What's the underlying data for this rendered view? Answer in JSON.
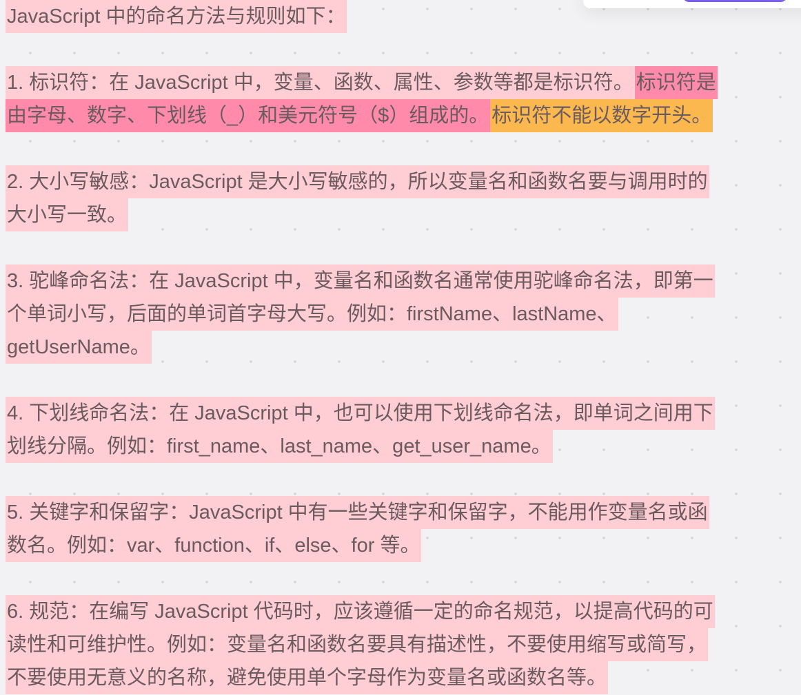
{
  "colors": {
    "light": "#ffcdd4",
    "pink": "#ff8aaa",
    "orange": "#fbb84f",
    "accent": "#7b5cf5"
  },
  "paragraphs": [
    [
      [
        {
          "t": "JavaScript 中的命名方法与规则如下：",
          "h": "light"
        }
      ]
    ],
    [
      [
        {
          "t": "1. 标识符：在 JavaScript 中，变量、函数、属性、参数等都是标识符。",
          "h": "light"
        },
        {
          "t": "标识符是",
          "h": "pink"
        }
      ],
      [
        {
          "t": "由字母、数字、下划线（_）和美元符号（$）组成的。",
          "h": "pink"
        },
        {
          "t": "标识符不能以数字开头。",
          "h": "orange"
        }
      ]
    ],
    [
      [
        {
          "t": "2. 大小写敏感：JavaScript 是大小写敏感的，所以变量名和函数名要与调用时的",
          "h": "light"
        }
      ],
      [
        {
          "t": "大小写一致。",
          "h": "light"
        }
      ]
    ],
    [
      [
        {
          "t": "3. 驼峰命名法：在 JavaScript 中，变量名和函数名通常使用驼峰命名法，即第一",
          "h": "light"
        }
      ],
      [
        {
          "t": "个单词小写，后面的单词首字母大写。例如：firstName、lastName、",
          "h": "light"
        }
      ],
      [
        {
          "t": "getUserName。",
          "h": "light"
        }
      ]
    ],
    [
      [
        {
          "t": "4. 下划线命名法：在 JavaScript 中，也可以使用下划线命名法，即单词之间用下",
          "h": "light"
        }
      ],
      [
        {
          "t": "划线分隔。例如：first_name、last_name、get_user_name。",
          "h": "light"
        }
      ]
    ],
    [
      [
        {
          "t": "5. 关键字和保留字：JavaScript 中有一些关键字和保留字，不能用作变量名或函",
          "h": "light"
        }
      ],
      [
        {
          "t": "数名。例如：var、function、if、else、for 等。",
          "h": "light"
        }
      ]
    ],
    [
      [
        {
          "t": "6. 规范：在编写 JavaScript 代码时，应该遵循一定的命名规范，以提高代码的可",
          "h": "light"
        }
      ],
      [
        {
          "t": "读性和可维护性。例如：变量名和函数名要具有描述性，不要使用缩写或简写，",
          "h": "light"
        }
      ],
      [
        {
          "t": "不要使用无意义的名称，避免使用单个字母作为变量名或函数名等。",
          "h": "light"
        }
      ]
    ]
  ]
}
